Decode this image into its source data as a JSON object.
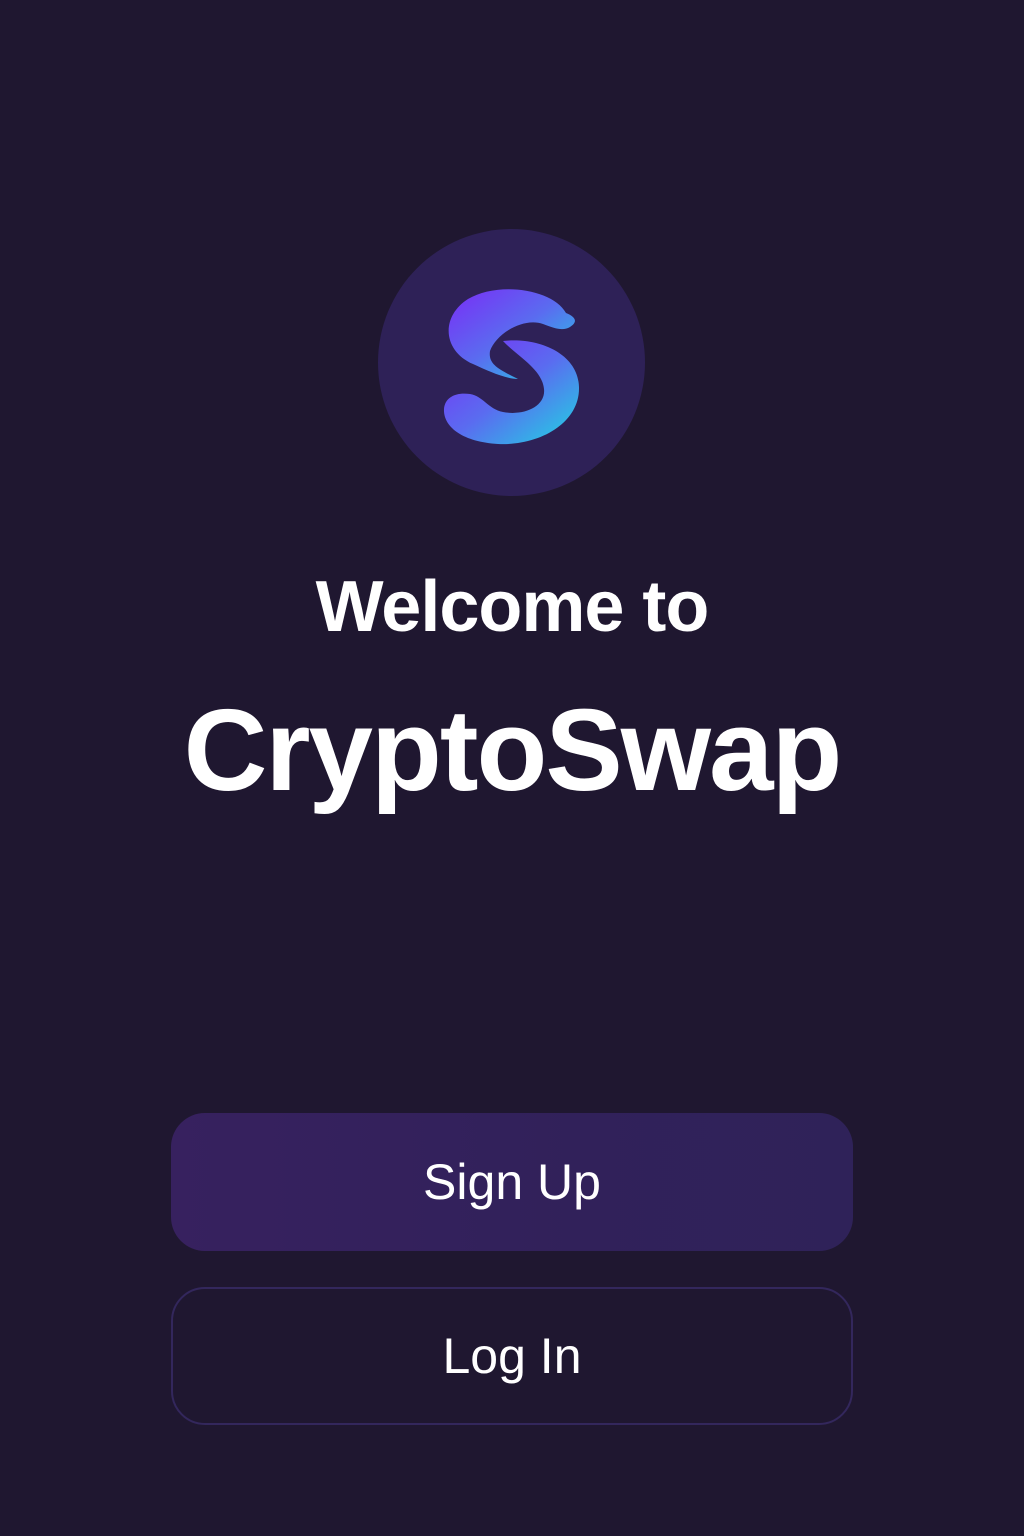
{
  "welcome": {
    "line1": "Welcome to",
    "app_name": "CryptoSwap"
  },
  "logo": {
    "icon": "s-swap-logo-icon",
    "circle_color": "#2e2157",
    "gradient_start": "#7a2cf6",
    "gradient_end": "#1fd6e2"
  },
  "actions": {
    "signup_label": "Sign Up",
    "login_label": "Log In"
  },
  "colors": {
    "background": "#1f1730",
    "primary_button": "#35215e",
    "secondary_button_border": "#33275c",
    "text": "#ffffff"
  }
}
